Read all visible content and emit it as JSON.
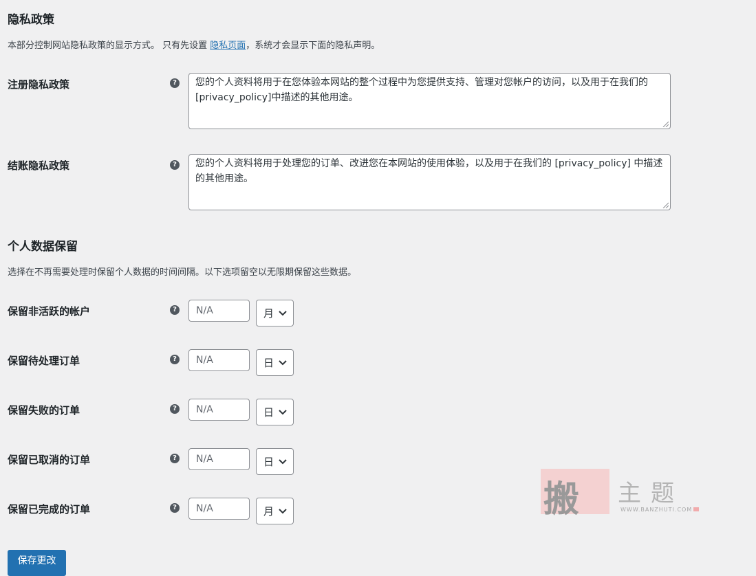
{
  "privacy": {
    "title": "隐私政策",
    "description_before": "本部分控制网站隐私政策的显示方式。 只有先设置 ",
    "description_link": "隐私页面",
    "description_after": "，系统才会显示下面的隐私声明。",
    "fields": [
      {
        "label": "注册隐私政策",
        "value": "您的个人资料将用于在您体验本网站的整个过程中为您提供支持、管理对您帐户的访问，以及用于在我们的[privacy_policy]中描述的其他用途。"
      },
      {
        "label": "结账隐私政策",
        "value": "您的个人资料将用于处理您的订单、改进您在本网站的使用体验，以及用于在我们的 [privacy_policy] 中描述的其他用途。"
      }
    ]
  },
  "retention": {
    "title": "个人数据保留",
    "description": "选择在不再需要处理时保留个人数据的时间间隔。以下选项留空以无限期保留这些数据。",
    "fields": [
      {
        "label": "保留非活跃的帐户",
        "placeholder": "N/A",
        "unit": "月"
      },
      {
        "label": "保留待处理订单",
        "placeholder": "N/A",
        "unit": "日"
      },
      {
        "label": "保留失败的订单",
        "placeholder": "N/A",
        "unit": "日"
      },
      {
        "label": "保留已取消的订单",
        "placeholder": "N/A",
        "unit": "日"
      },
      {
        "label": "保留已完成的订单",
        "placeholder": "N/A",
        "unit": "月"
      }
    ]
  },
  "help_glyph": "?",
  "save_button": "保存更改",
  "watermark": {
    "stamp": "搬",
    "text": "主题",
    "url": "WWW.BANZHUTI.COM"
  }
}
